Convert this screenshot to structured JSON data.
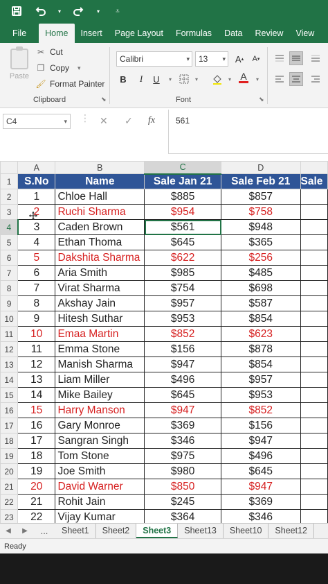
{
  "qat": {
    "icons": [
      "save-icon",
      "undo-icon",
      "redo-icon",
      "customize-icon"
    ]
  },
  "tabs": [
    "File",
    "Home",
    "Insert",
    "Page Layout",
    "Formulas",
    "Data",
    "Review",
    "View"
  ],
  "active_tab": "Home",
  "clipboard": {
    "paste": "Paste",
    "cut": "Cut",
    "copy": "Copy",
    "format_painter": "Format Painter",
    "group_label": "Clipboard"
  },
  "font": {
    "name": "Calibri",
    "size": "13",
    "grow": "A",
    "shrink": "A",
    "bold": "B",
    "italic": "I",
    "underline": "U",
    "font_color_letter": "A",
    "group_label": "Font"
  },
  "formula_bar": {
    "name_box": "C4",
    "fx": "fx",
    "value": "561"
  },
  "columns": [
    "A",
    "B",
    "C",
    "D"
  ],
  "header_row": [
    "S.No",
    "Name",
    "Sale Jan 21",
    "Sale Feb 21",
    "Sale"
  ],
  "rows": [
    {
      "row": "2",
      "sno": "1",
      "name": "Chloe Hall",
      "jan": "$885",
      "feb": "$857",
      "red": false
    },
    {
      "row": "3",
      "sno": "2",
      "name": "Ruchi Sharma",
      "jan": "$954",
      "feb": "$758",
      "red": true
    },
    {
      "row": "4",
      "sno": "3",
      "name": "Caden Brown",
      "jan": "$561",
      "feb": "$948",
      "red": false
    },
    {
      "row": "5",
      "sno": "4",
      "name": "Ethan Thoma",
      "jan": "$645",
      "feb": "$365",
      "red": false
    },
    {
      "row": "6",
      "sno": "5",
      "name": "Dakshita Sharma",
      "jan": "$622",
      "feb": "$256",
      "red": true
    },
    {
      "row": "7",
      "sno": "6",
      "name": "Aria Smith",
      "jan": "$985",
      "feb": "$485",
      "red": false
    },
    {
      "row": "8",
      "sno": "7",
      "name": "Virat Sharma",
      "jan": "$754",
      "feb": "$698",
      "red": false
    },
    {
      "row": "9",
      "sno": "8",
      "name": "Akshay Jain",
      "jan": "$957",
      "feb": "$587",
      "red": false
    },
    {
      "row": "10",
      "sno": "9",
      "name": "Hitesh Suthar",
      "jan": "$953",
      "feb": "$854",
      "red": false
    },
    {
      "row": "11",
      "sno": "10",
      "name": "Emaa Martin",
      "jan": "$852",
      "feb": "$623",
      "red": true
    },
    {
      "row": "12",
      "sno": "11",
      "name": "Emma Stone",
      "jan": "$156",
      "feb": "$878",
      "red": false
    },
    {
      "row": "13",
      "sno": "12",
      "name": "Manish Sharma",
      "jan": "$947",
      "feb": "$854",
      "red": false
    },
    {
      "row": "14",
      "sno": "13",
      "name": "Liam Miller",
      "jan": "$496",
      "feb": "$957",
      "red": false
    },
    {
      "row": "15",
      "sno": "14",
      "name": "Mike Bailey",
      "jan": "$645",
      "feb": "$953",
      "red": false
    },
    {
      "row": "16",
      "sno": "15",
      "name": "Harry Manson",
      "jan": "$947",
      "feb": "$852",
      "red": true
    },
    {
      "row": "17",
      "sno": "16",
      "name": "Gary Monroe",
      "jan": "$369",
      "feb": "$156",
      "red": false
    },
    {
      "row": "18",
      "sno": "17",
      "name": "Sangran Singh",
      "jan": "$346",
      "feb": "$947",
      "red": false
    },
    {
      "row": "19",
      "sno": "18",
      "name": "Tom Stone",
      "jan": "$975",
      "feb": "$496",
      "red": false
    },
    {
      "row": "20",
      "sno": "19",
      "name": "Joe Smith",
      "jan": "$980",
      "feb": "$645",
      "red": false
    },
    {
      "row": "21",
      "sno": "20",
      "name": "David Warner",
      "jan": "$850",
      "feb": "$947",
      "red": true
    },
    {
      "row": "22",
      "sno": "21",
      "name": "Rohit Jain",
      "jan": "$245",
      "feb": "$369",
      "red": false
    },
    {
      "row": "23",
      "sno": "22",
      "name": "Vijay Kumar",
      "jan": "$364",
      "feb": "$346",
      "red": false
    }
  ],
  "header_row_number": "1",
  "selected_cell": "C4",
  "sheet_nav_dots": "...",
  "sheets": [
    "Sheet1",
    "Sheet2",
    "Sheet3",
    "Sheet13",
    "Sheet10",
    "Sheet12"
  ],
  "active_sheet": "Sheet3",
  "status": "Ready",
  "colors": {
    "excel_green": "#217346",
    "header_blue": "#2f5597",
    "red_text": "#d61f1f"
  }
}
